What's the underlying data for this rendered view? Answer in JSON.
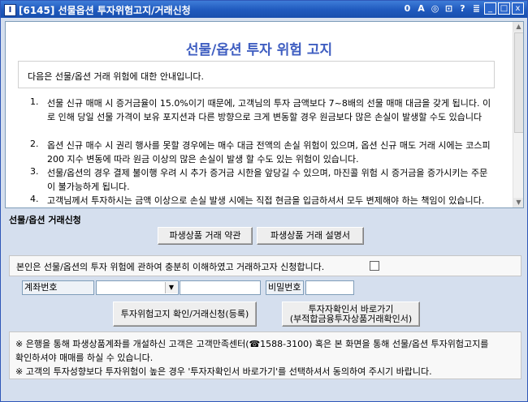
{
  "window": {
    "title": "[6145]  선물옵션 투자위험고지/거래신청",
    "app_icon": "I",
    "toolbar_icons": [
      "0",
      "A",
      "◎",
      "⊡",
      "?",
      "≣"
    ],
    "controls": [
      "_",
      "□",
      "x"
    ]
  },
  "notice": {
    "title": "선물/옵션 투자 위험 고지",
    "intro": "다음은 선물/옵션 거래 위험에 대한 안내입니다.",
    "items": [
      {
        "num": "1.",
        "text": "선물 신규 매매 시 증거금율이 15.0%이기 때문에, 고객님의 투자 금액보다 7~8배의 선물 매매 대금을 갖게 됩니다. 이로 인해 당일 선물 가격이 보유 포지션과 다른 방향으로 크게 변동할 경우 원금보다 많은 손실이 발생할 수도 있습니다"
      },
      {
        "num": "2.",
        "text": "옵션 신규 매수 시 권리 행사를 못할 경우에는 매수 대금 전액의 손실 위험이 있으며, 옵션 신규 매도 거래 시에는 코스피200 지수 변동에 따라 원금 이상의 많은 손실이 발생 할 수도 있는 위험이 있습니다."
      },
      {
        "num": "3.",
        "text": "선물/옵션의 경우 결제 불이행 우려 시 추가 증거금 시한을 앞당길 수 있으며, 마진콜 위험 시 증거금을 증가시키는 주문이 불가능하게 됩니다."
      },
      {
        "num": "4.",
        "text": "고객님께서 투자하시는 금액 이상으로 손실 발생 시에는 직접 현금을 입금하셔서 모두 변제해야 하는 책임이 있습니다."
      }
    ]
  },
  "application": {
    "section_title": "선물/옵션 거래신청",
    "terms_button": "파생상품 거래 약관",
    "description_button": "파생상품 거래 설명서",
    "agreement_text": "본인은 선물/옵션의 투자 위험에 관하여 충분히 이해하였고 거래하고자 신청합니다.",
    "account_label": "계좌번호",
    "password_label": "비밀번호",
    "confirm_button": "투자위험고지 확인/거래신청(등록)",
    "investor_button_line1": "투자자확인서 바로가기",
    "investor_button_line2": "(부적합금융투자상품거래확인서)"
  },
  "footer": {
    "notes": [
      "※ 은행을 통해 파생상품계좌를 개설하신 고객은 고객만족센터(☎1588-3100) 혹은 본 화면을 통해 선물/옵션 투자위험고지를",
      "    확인하셔야 매매를 하실 수 있습니다.",
      "※ 고객의 투자성향보다 투자위험이 높은 경우 '투자자확인서 바로가기'를 선택하셔서 동의하여 주시기 바랍니다."
    ]
  }
}
